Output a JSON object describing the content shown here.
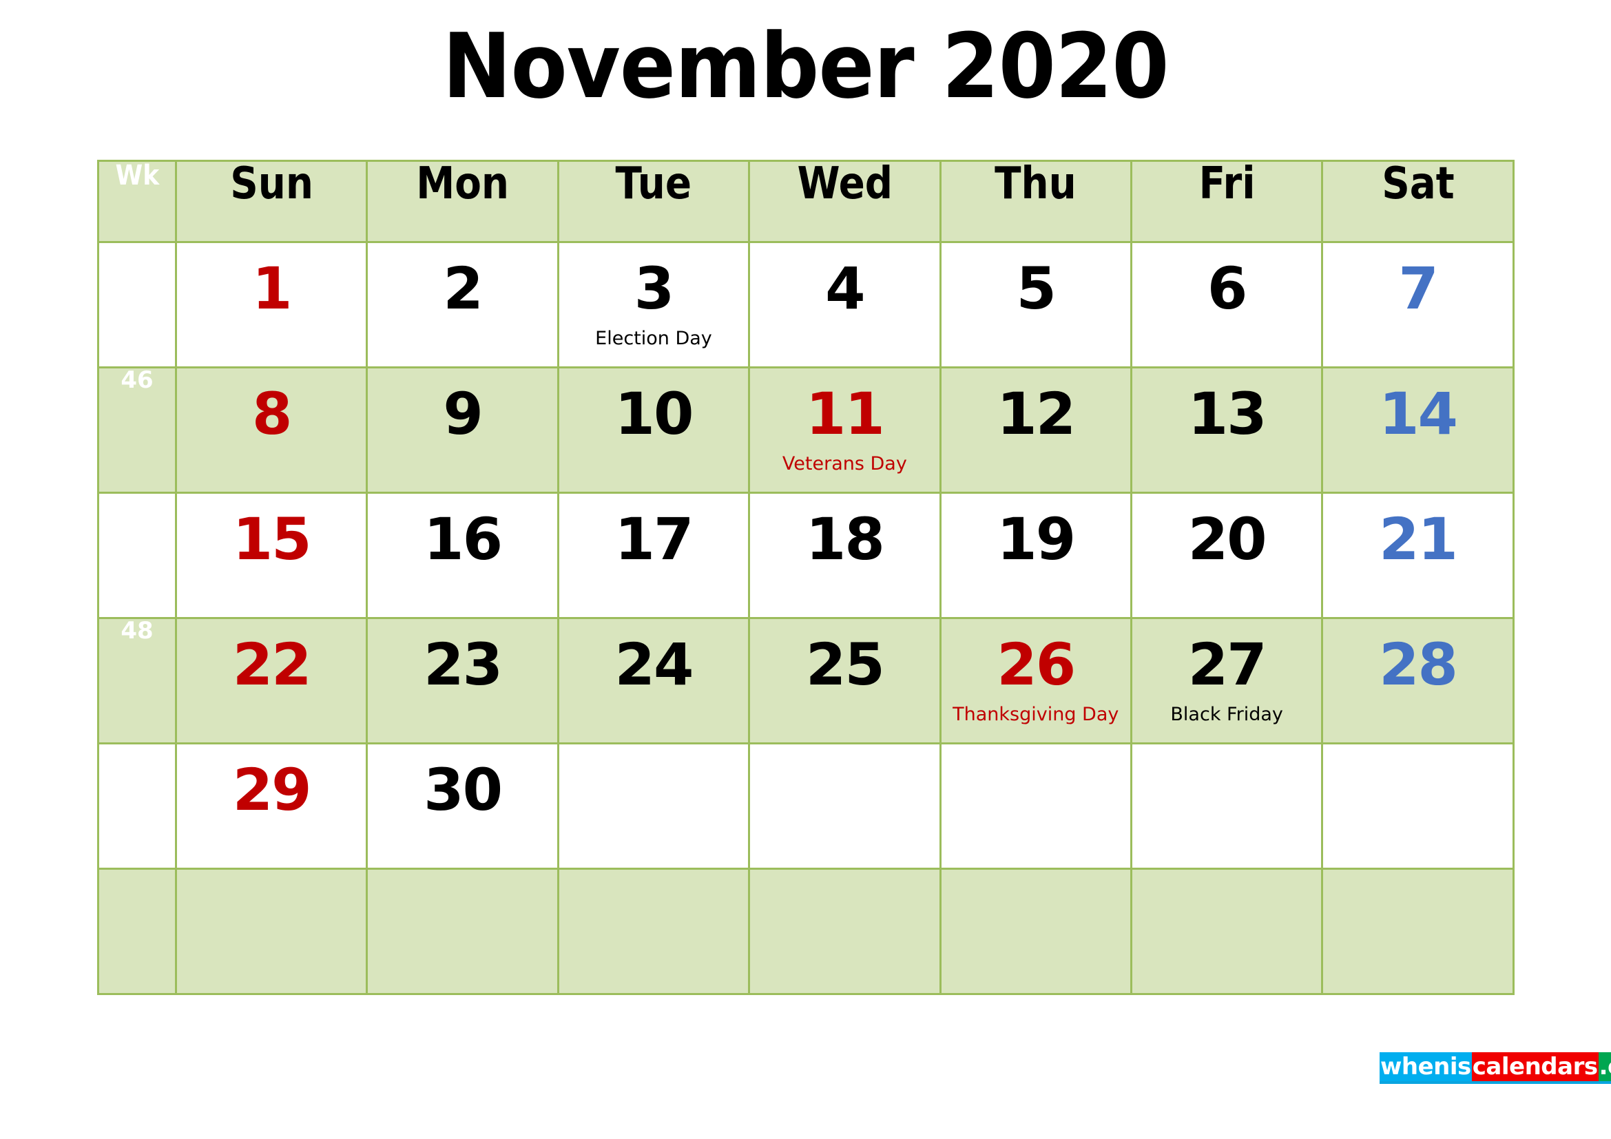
{
  "title": "November 2020",
  "header": {
    "week_label": "Wk",
    "days": [
      "Sun",
      "Mon",
      "Tue",
      "Wed",
      "Thu",
      "Fri",
      "Sat"
    ]
  },
  "colors": {
    "cell_green": "#d9e5be",
    "border_green": "#9cbd5c",
    "sunday_red": "#c00000",
    "saturday_blue": "#4472c4",
    "holiday_red": "#c00000",
    "logo_blue": "#00aeef",
    "logo_red": "#f00000",
    "logo_green": "#00a651"
  },
  "weeks": [
    {
      "wk": "",
      "shaded": false,
      "days": [
        {
          "num": "1",
          "event": "",
          "color": "red"
        },
        {
          "num": "2",
          "event": "",
          "color": "black"
        },
        {
          "num": "3",
          "event": "Election Day",
          "color": "black",
          "event_color": "black"
        },
        {
          "num": "4",
          "event": "",
          "color": "black"
        },
        {
          "num": "5",
          "event": "",
          "color": "black"
        },
        {
          "num": "6",
          "event": "",
          "color": "black"
        },
        {
          "num": "7",
          "event": "",
          "color": "blue"
        }
      ]
    },
    {
      "wk": "46",
      "shaded": true,
      "days": [
        {
          "num": "8",
          "event": "",
          "color": "red"
        },
        {
          "num": "9",
          "event": "",
          "color": "black"
        },
        {
          "num": "10",
          "event": "",
          "color": "black"
        },
        {
          "num": "11",
          "event": "Veterans Day",
          "color": "red",
          "event_color": "red"
        },
        {
          "num": "12",
          "event": "",
          "color": "black"
        },
        {
          "num": "13",
          "event": "",
          "color": "black"
        },
        {
          "num": "14",
          "event": "",
          "color": "blue"
        }
      ]
    },
    {
      "wk": "",
      "shaded": false,
      "days": [
        {
          "num": "15",
          "event": "",
          "color": "red"
        },
        {
          "num": "16",
          "event": "",
          "color": "black"
        },
        {
          "num": "17",
          "event": "",
          "color": "black"
        },
        {
          "num": "18",
          "event": "",
          "color": "black"
        },
        {
          "num": "19",
          "event": "",
          "color": "black"
        },
        {
          "num": "20",
          "event": "",
          "color": "black"
        },
        {
          "num": "21",
          "event": "",
          "color": "blue"
        }
      ]
    },
    {
      "wk": "48",
      "shaded": true,
      "days": [
        {
          "num": "22",
          "event": "",
          "color": "red"
        },
        {
          "num": "23",
          "event": "",
          "color": "black"
        },
        {
          "num": "24",
          "event": "",
          "color": "black"
        },
        {
          "num": "25",
          "event": "",
          "color": "black"
        },
        {
          "num": "26",
          "event": "Thanksgiving Day",
          "color": "red",
          "event_color": "red"
        },
        {
          "num": "27",
          "event": "Black Friday",
          "color": "black",
          "event_color": "black"
        },
        {
          "num": "28",
          "event": "",
          "color": "blue"
        }
      ]
    },
    {
      "wk": "",
      "shaded": false,
      "days": [
        {
          "num": "29",
          "event": "",
          "color": "red"
        },
        {
          "num": "30",
          "event": "",
          "color": "black"
        },
        {
          "num": "",
          "event": "",
          "color": "black"
        },
        {
          "num": "",
          "event": "",
          "color": "black"
        },
        {
          "num": "",
          "event": "",
          "color": "black"
        },
        {
          "num": "",
          "event": "",
          "color": "black"
        },
        {
          "num": "",
          "event": "",
          "color": "blue"
        }
      ]
    },
    {
      "wk": "",
      "shaded": true,
      "filler": true,
      "days": [
        {
          "num": "",
          "event": "",
          "color": "black"
        },
        {
          "num": "",
          "event": "",
          "color": "black"
        },
        {
          "num": "",
          "event": "",
          "color": "black"
        },
        {
          "num": "",
          "event": "",
          "color": "black"
        },
        {
          "num": "",
          "event": "",
          "color": "black"
        },
        {
          "num": "",
          "event": "",
          "color": "black"
        },
        {
          "num": "",
          "event": "",
          "color": "black"
        }
      ]
    }
  ],
  "logo": {
    "part1": "whenis",
    "part2": "calendars",
    "part3": ".com"
  }
}
